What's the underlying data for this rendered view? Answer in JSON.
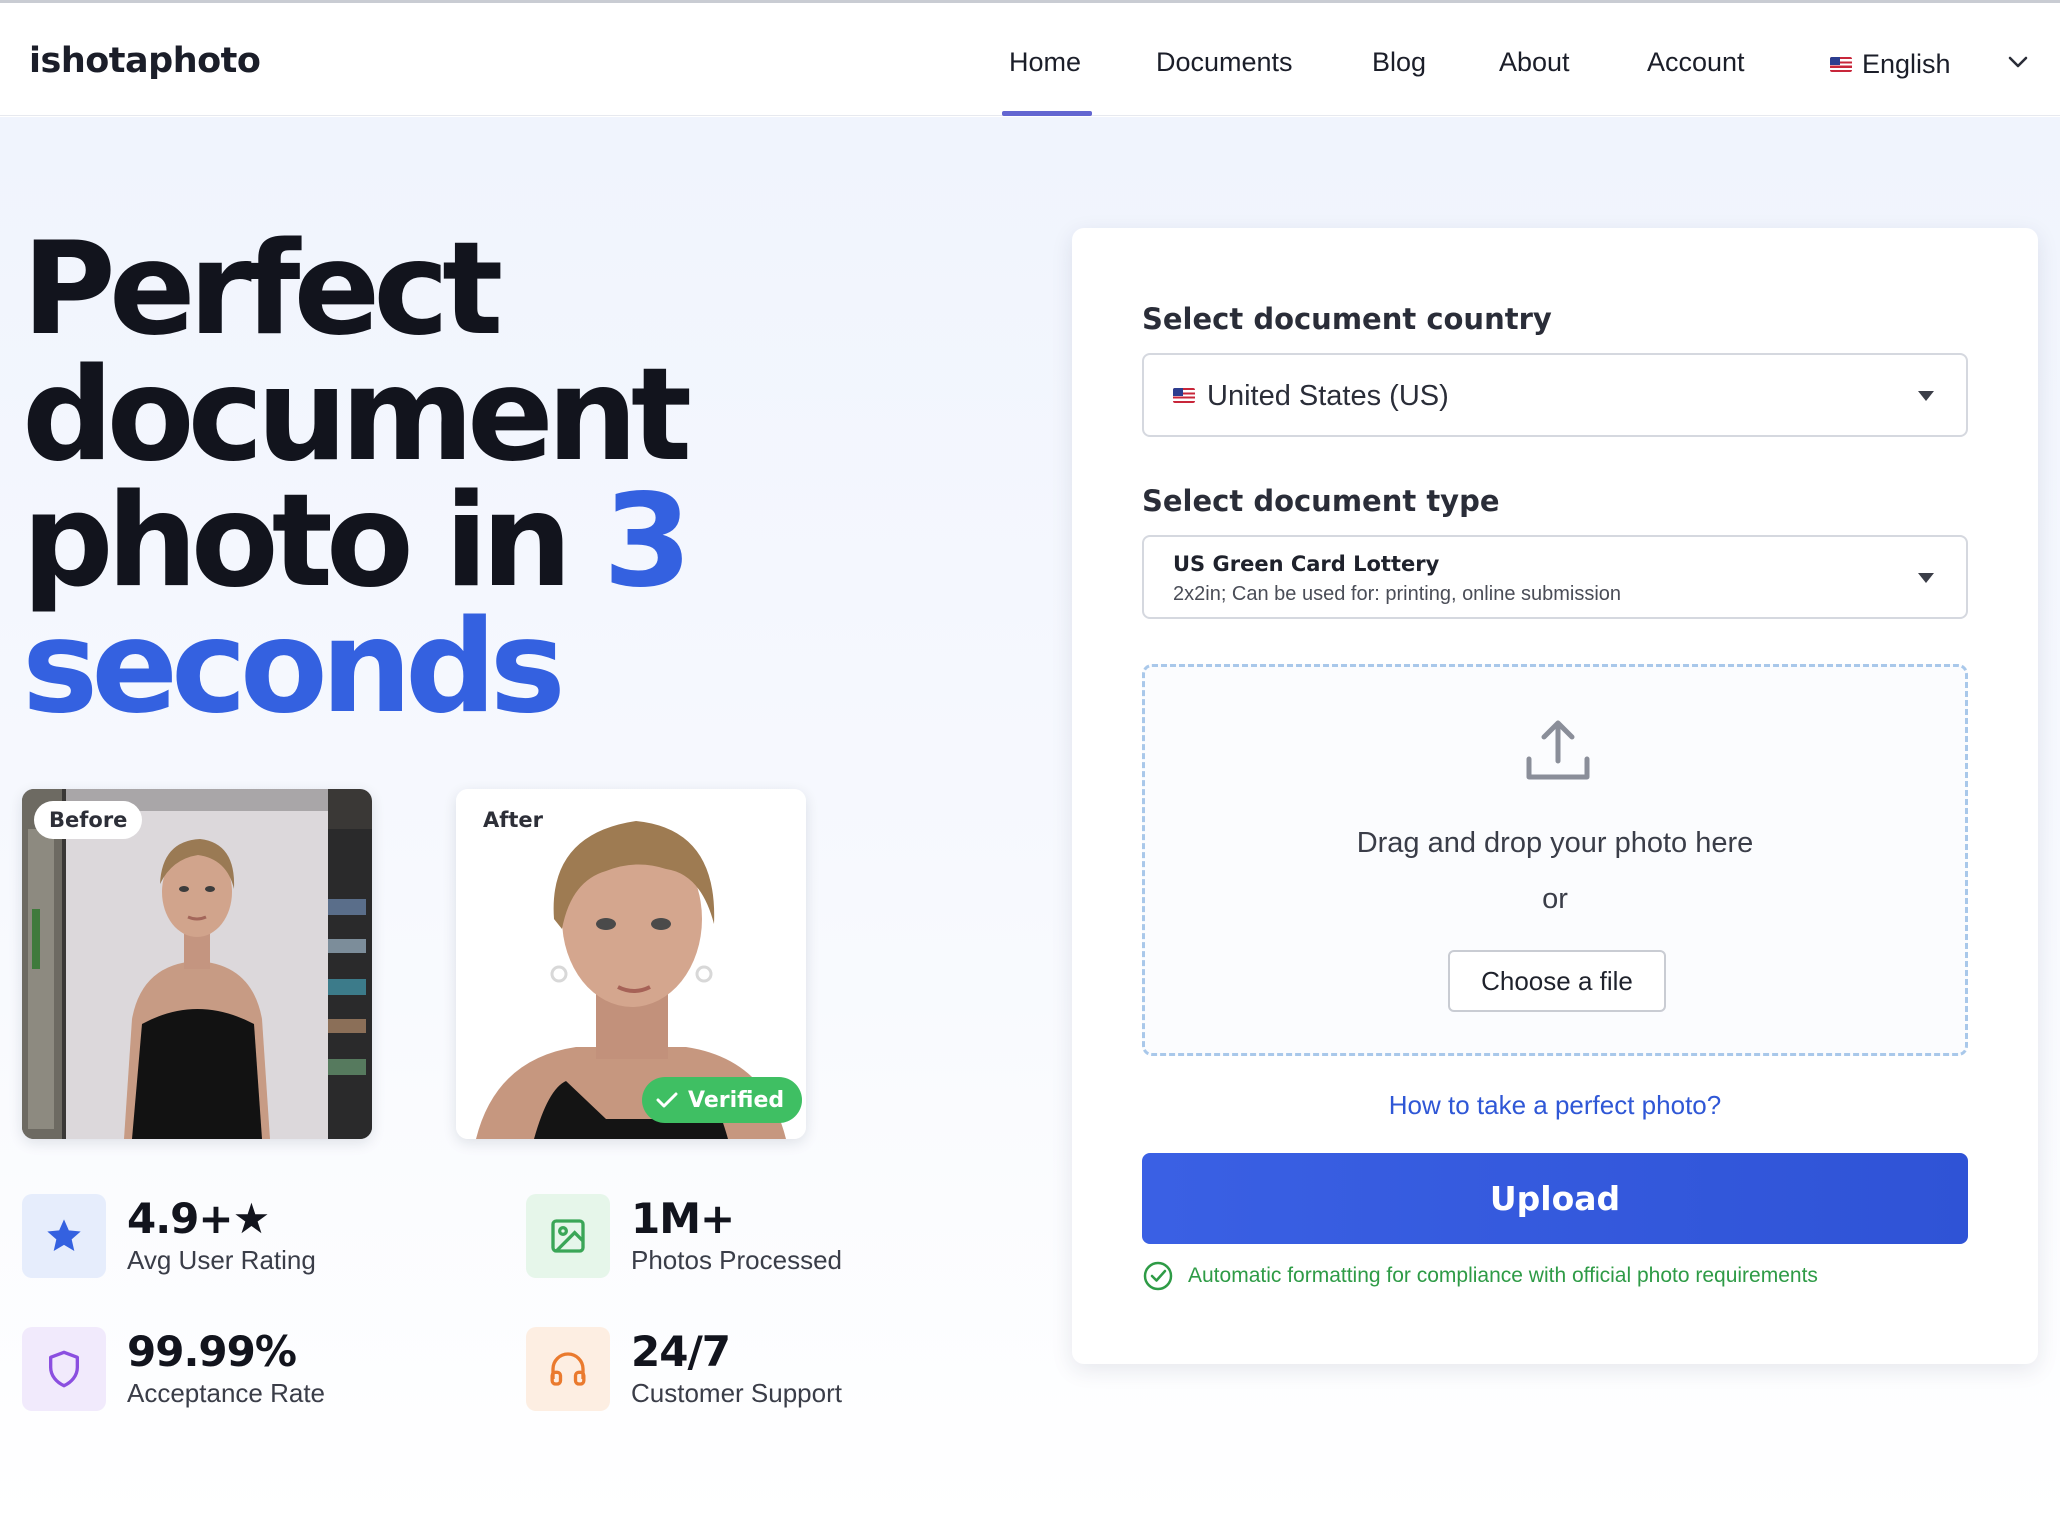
{
  "header": {
    "logo": "ishotaphoto",
    "nav": [
      {
        "label": "Home",
        "active": true
      },
      {
        "label": "Documents"
      },
      {
        "label": "Blog"
      },
      {
        "label": "About"
      },
      {
        "label": "Account"
      }
    ],
    "language": "English",
    "language_flag_icon": "us-flag-icon",
    "language_chevron_icon": "chevron-down-icon"
  },
  "hero": {
    "headline_part1": "Perfect document photo in",
    "headline_accent_number": "3",
    "headline_accent_word": "seconds",
    "accent_color": "#3461e0",
    "before_label": "Before",
    "after_label": "After",
    "verified_label": "Verified"
  },
  "stats": [
    {
      "value": "4.9+★",
      "label": "Avg User Rating",
      "icon": "star-icon",
      "icon_color": "#3461e0",
      "icon_bg": "#e6edfc"
    },
    {
      "value": "1M+",
      "label": "Photos Processed",
      "icon": "image-icon",
      "icon_color": "#3aa657",
      "icon_bg": "#e6f6ea"
    },
    {
      "value": "99.99%",
      "label": "Acceptance Rate",
      "icon": "shield-icon",
      "icon_color": "#8b4fe0",
      "icon_bg": "#f1eafc"
    },
    {
      "value": "24/7",
      "label": "Customer Support",
      "icon": "headphones-icon",
      "icon_color": "#ea7a2e",
      "icon_bg": "#fdeee2"
    }
  ],
  "form": {
    "country_label": "Select document country",
    "country_value": "United States (US)",
    "country_flag_icon": "us-flag-icon",
    "type_label": "Select document type",
    "type_title": "US Green Card Lottery",
    "type_subtitle": "2x2in; Can be used for: printing, online submission",
    "drop_text": "Drag and drop your photo here",
    "or_text": "or",
    "choose_button": "Choose a file",
    "howto_link": "How to take a perfect photo?",
    "upload_button": "Upload",
    "compliance_note": "Automatic formatting for compliance with official photo requirements",
    "primary_color": "#3461e0",
    "success_color": "#2e9b46"
  }
}
